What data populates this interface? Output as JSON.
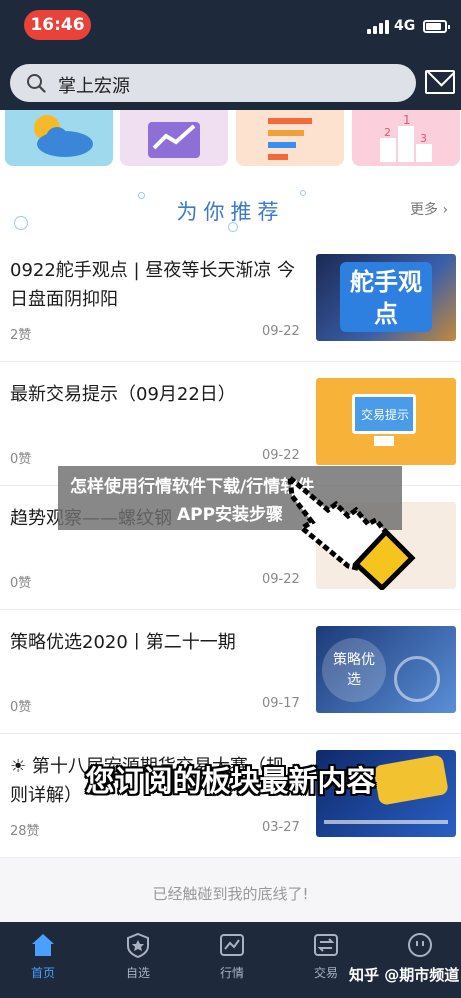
{
  "status_bar": {
    "time": "16:46",
    "network": "4G",
    "battery_level": 0.85
  },
  "search": {
    "placeholder": "掌上宏源"
  },
  "recommend": {
    "title": "为你推荐",
    "more": "更多"
  },
  "feed": [
    {
      "title": "0922舵手观点 | 昼夜等长天渐凉 今日盘面阴抑阳",
      "likes": "2赞",
      "date": "09-22",
      "thumb_text": "舵手观点"
    },
    {
      "title": "最新交易提示（09月22日）",
      "likes": "0赞",
      "date": "09-22",
      "thumb_text": "交易提示"
    },
    {
      "title": "趋势观察——螺纹钢",
      "likes": "0赞",
      "date": "09-22",
      "thumb_text": ""
    },
    {
      "title": "策略优选2020丨第二十一期",
      "likes": "0赞",
      "date": "09-17",
      "thumb_text": "策略优选"
    },
    {
      "title": "☀ 第十八届宏源期货交易大赛（规则详解）",
      "likes": "28赞",
      "date": "03-27",
      "thumb_text": ""
    }
  ],
  "end_text": "已经触碰到我的底线了!",
  "tabs": [
    {
      "label": "首页",
      "icon": "home-icon",
      "active": true
    },
    {
      "label": "自选",
      "icon": "star-shield-icon",
      "active": false
    },
    {
      "label": "行情",
      "icon": "chart-icon",
      "active": false
    },
    {
      "label": "交易",
      "icon": "exchange-icon",
      "active": false
    },
    {
      "label": "我的",
      "icon": "smile-icon",
      "active": false
    }
  ],
  "overlay": {
    "line1": "怎样使用行情软件下载/行情软件",
    "line2": "APP安装步骤",
    "caption": "您订阅的板块最新内容"
  },
  "watermark": "知乎 @期市频道",
  "colors": {
    "accent": "#3d79c9",
    "status_red": "#e8423a",
    "dark_bar": "#1e2a3c"
  }
}
